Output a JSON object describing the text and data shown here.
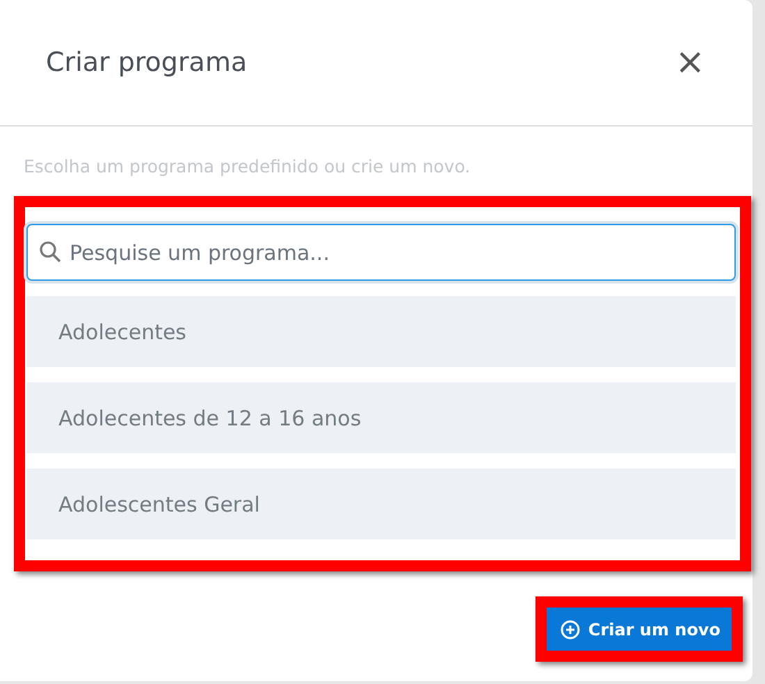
{
  "dialog": {
    "title": "Criar programa",
    "close": "×",
    "subtitle": "Escolha um programa predefinido ou crie um novo."
  },
  "search": {
    "placeholder": "Pesquise um programa..."
  },
  "programs": [
    {
      "name": "Adolecentes"
    },
    {
      "name": "Adolecentes de 12 a 16 anos"
    },
    {
      "name": "Adolescentes Geral"
    }
  ],
  "create_button": {
    "label": "Criar um novo"
  }
}
